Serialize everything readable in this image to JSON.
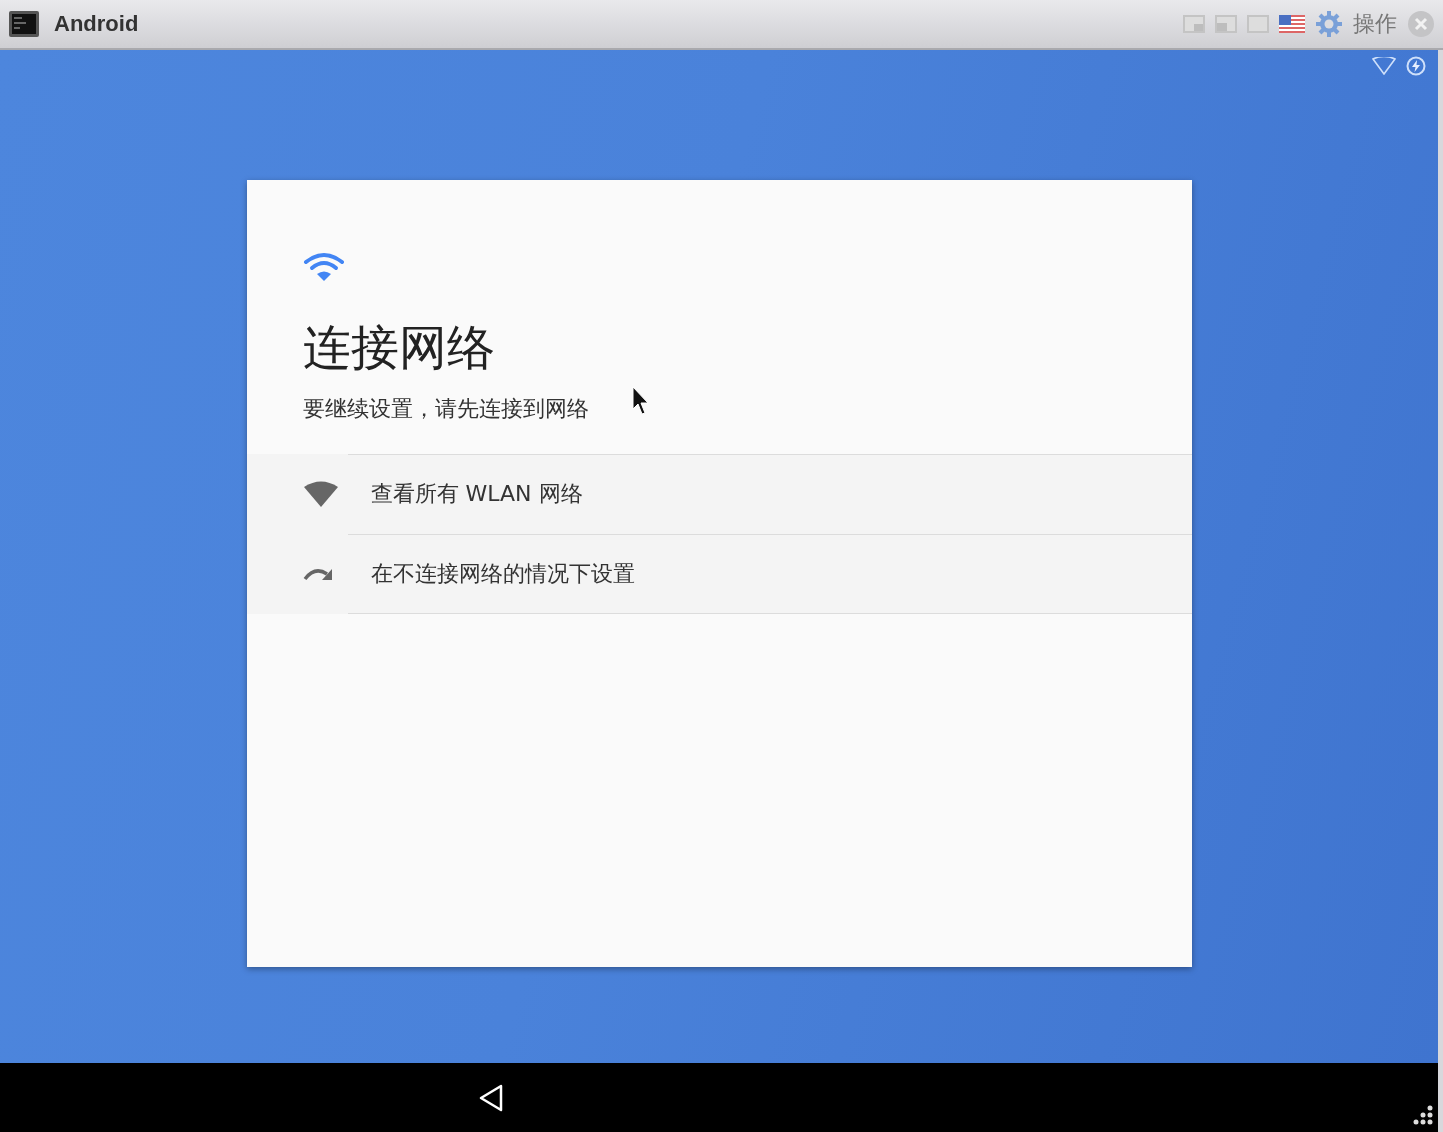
{
  "window": {
    "title": "Android",
    "toolbar_label": "操作"
  },
  "setup_card": {
    "title": "连接网络",
    "subtitle": "要继续设置，请先连接到网络",
    "options": [
      {
        "kind": "wifi",
        "label": "查看所有 WLAN 网络"
      },
      {
        "kind": "skip",
        "label": "在不连接网络的情况下设置"
      }
    ]
  }
}
